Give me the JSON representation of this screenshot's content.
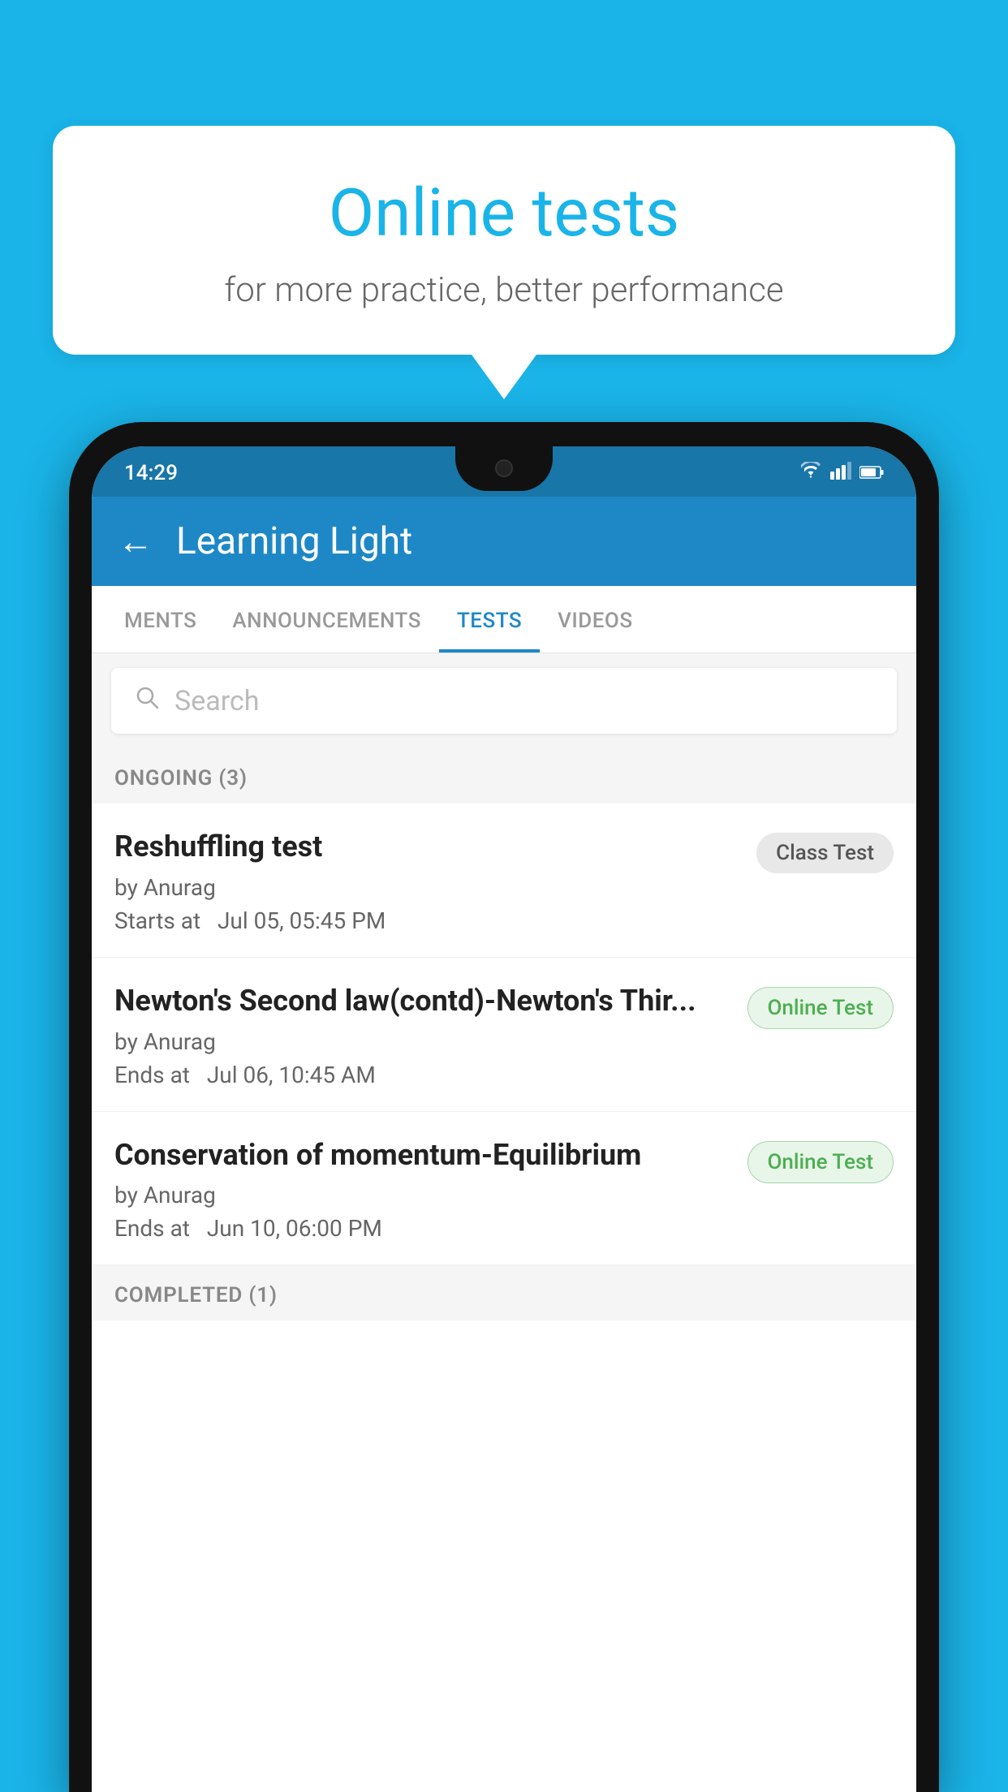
{
  "background": {
    "color": "#1ab4e8"
  },
  "speech_bubble": {
    "title": "Online tests",
    "subtitle": "for more practice, better performance"
  },
  "phone": {
    "status_bar": {
      "time": "14:29",
      "wifi": "▾",
      "signal": "▲",
      "battery": "▮"
    },
    "app_header": {
      "back_label": "←",
      "title": "Learning Light"
    },
    "tabs": [
      {
        "label": "MENTS",
        "active": false
      },
      {
        "label": "ANNOUNCEMENTS",
        "active": false
      },
      {
        "label": "TESTS",
        "active": true
      },
      {
        "label": "VIDEOS",
        "active": false
      }
    ],
    "search": {
      "placeholder": "Search"
    },
    "section_ongoing": {
      "label": "ONGOING (3)"
    },
    "tests": [
      {
        "name": "Reshuffling test",
        "author": "by Anurag",
        "date_label": "Starts at",
        "date": "Jul 05, 05:45 PM",
        "badge": "Class Test",
        "badge_type": "class"
      },
      {
        "name": "Newton's Second law(contd)-Newton's Thir...",
        "author": "by Anurag",
        "date_label": "Ends at",
        "date": "Jul 06, 10:45 AM",
        "badge": "Online Test",
        "badge_type": "online"
      },
      {
        "name": "Conservation of momentum-Equilibrium",
        "author": "by Anurag",
        "date_label": "Ends at",
        "date": "Jun 10, 06:00 PM",
        "badge": "Online Test",
        "badge_type": "online"
      }
    ],
    "section_completed": {
      "label": "COMPLETED (1)"
    }
  }
}
